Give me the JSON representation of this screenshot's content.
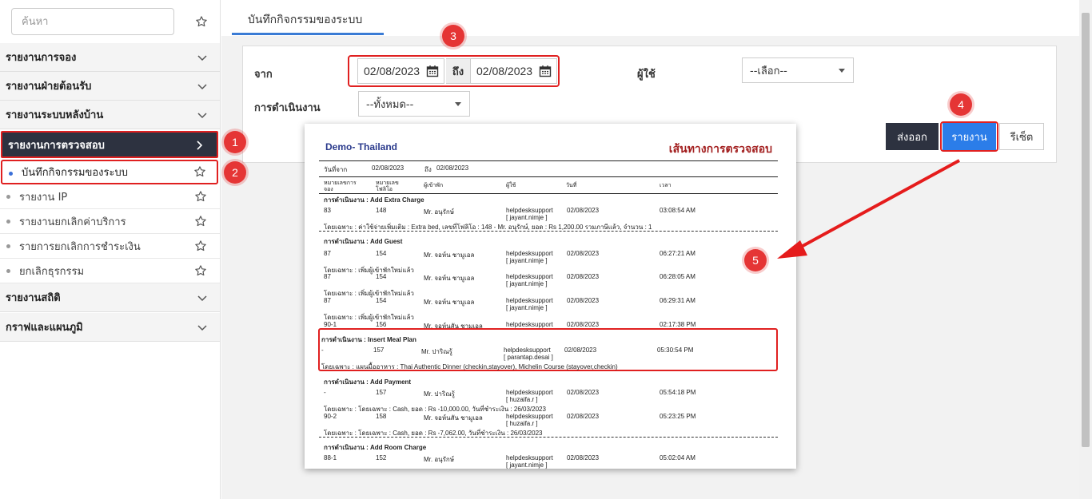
{
  "sidebar": {
    "search_placeholder": "ค้นหา",
    "sections": [
      {
        "label": "รายงานการจอง"
      },
      {
        "label": "รายงานฝ่ายต้อนรับ"
      },
      {
        "label": "รายงานระบบหลังบ้าน"
      },
      {
        "label": "รายงานการตรวจสอบ"
      },
      {
        "label": "รายงานสถิติ"
      },
      {
        "label": "กราฟและแผนภูมิ"
      }
    ],
    "subitems": [
      {
        "label": "บันทึกกิจกรรมของระบบ"
      },
      {
        "label": "รายงาน IP"
      },
      {
        "label": "รายงานยกเลิกค่าบริการ"
      },
      {
        "label": "รายการยกเลิกการชำระเงิน"
      },
      {
        "label": "ยกเลิกธุรกรรม"
      }
    ]
  },
  "tab": {
    "label": "บันทึกกิจกรรมของระบบ"
  },
  "form": {
    "from_label": "จาก",
    "from_date": "02/08/2023",
    "to_label": "ถึง",
    "to_date": "02/08/2023",
    "user_label": "ผู้ใช้",
    "user_value": "--เลือก--",
    "operation_label": "การดำเนินงาน",
    "operation_value": "--ทั้งหมด--",
    "export_label": "ส่งออก",
    "report_label": "รายงาน",
    "reset_label": "รีเซ็ต"
  },
  "badges": [
    "1",
    "2",
    "3",
    "4",
    "5"
  ],
  "report": {
    "company": "Demo- Thailand",
    "title": "เส้นทางการตรวจสอบ",
    "date_from_label": "วันที่จาก",
    "date_from": "02/08/2023",
    "date_to_label": "ถึง",
    "date_to": "02/08/2023",
    "col_res_1": "หมายเลขการ",
    "col_res_2": "จอง",
    "col_folio_1": "หมายเลข",
    "col_folio_2": "โฟลิโอ",
    "col_guest": "ผู้เข้าพัก",
    "col_user": "ผู้ใช้",
    "col_date": "วันที่",
    "col_time": "เวลา",
    "op1": "การดำเนินงาน : Add Extra Charge",
    "r1": {
      "res": "83",
      "folio": "148",
      "guest": "Mr. อนุรักษ์",
      "user": "helpdesksupport",
      "login": "[ jayant.nimje ]",
      "date": "02/08/2023",
      "time": "03:08:54 AM"
    },
    "d1": "โดยเฉพาะ : ค่าใช้จ่ายเพิ่มเติม : Extra bed, เลขที่โฟลิโอ : 148 - Mr. อนุรักษ์, ยอด : Rs 1,200.00 รวมภาษีแล้ว, จำนวน : 1",
    "op2": "การดำเนินงาน : Add Guest",
    "r2": {
      "res": "87",
      "folio": "154",
      "guest": "Mr. จอห์น ชามูเอล",
      "user": "helpdesksupport",
      "login": "[ jayant.nimje ]",
      "date": "02/08/2023",
      "time": "06:27:21 AM"
    },
    "d2": "โดยเฉพาะ : เพิ่มผู้เข้าพักใหม่แล้ว",
    "r3": {
      "res": "87",
      "folio": "154",
      "guest": "Mr. จอห์น ชามูเอล",
      "user": "helpdesksupport",
      "login": "[ jayant.nimje ]",
      "date": "02/08/2023",
      "time": "06:28:05 AM"
    },
    "d3": "โดยเฉพาะ : เพิ่มผู้เข้าพักใหม่แล้ว",
    "r4": {
      "res": "87",
      "folio": "154",
      "guest": "Mr. จอห์น ชามูเอล",
      "user": "helpdesksupport",
      "login": "[ jayant.nimje ]",
      "date": "02/08/2023",
      "time": "06:29:31 AM"
    },
    "d4": "โดยเฉพาะ : เพิ่มผู้เข้าพักใหม่แล้ว",
    "r5": {
      "res": "90-1",
      "folio": "156",
      "guest": "Mr. จอห์นสัน ชามูเอล",
      "user": "helpdesksupport",
      "date": "02/08/2023",
      "time": "02:17:38 PM"
    },
    "op3": "การดำเนินงาน : Insert Meal Plan",
    "r6": {
      "res": "-",
      "folio": "157",
      "guest": "Mr. ปาริณรู้",
      "user": "helpdesksupport",
      "login": "[ parantap.desai ]",
      "date": "02/08/2023",
      "time": "05:30:54 PM"
    },
    "d6": "โดยเฉพาะ : แผนมื้ออาหาร : Thai Authentic Dinner (checkin,stayover), Michelin Course (stayover,checkin)",
    "op4": "การดำเนินงาน : Add Payment",
    "r7": {
      "res": "-",
      "folio": "157",
      "guest": "Mr. ปาริณรู้",
      "user": "helpdesksupport",
      "login": "[ huzaifa.r ]",
      "date": "02/08/2023",
      "time": "05:54:18 PM"
    },
    "d7": "โดยเฉพาะ : โดยเฉพาะ : Cash, ยอด : Rs -10,000.00, วันที่ชำระเงิน : 26/03/2023",
    "r8": {
      "res": "90-2",
      "folio": "158",
      "guest": "Mr. จอห์นสัน ชามูเอล",
      "user": "helpdesksupport",
      "login": "[ huzaifa.r ]",
      "date": "02/08/2023",
      "time": "05:23:25 PM"
    },
    "d8": "โดยเฉพาะ : โดยเฉพาะ : Cash, ยอด : Rs -7,062.00, วันที่ชำระเงิน : 26/03/2023",
    "op5": "การดำเนินงาน : Add Room Charge",
    "r9": {
      "res": "88-1",
      "folio": "152",
      "guest": "Mr. อนุรักษ์",
      "user": "helpdesksupport",
      "login": "[ jayant.nimje ]",
      "date": "02/08/2023",
      "time": "05:02:04 AM"
    }
  }
}
